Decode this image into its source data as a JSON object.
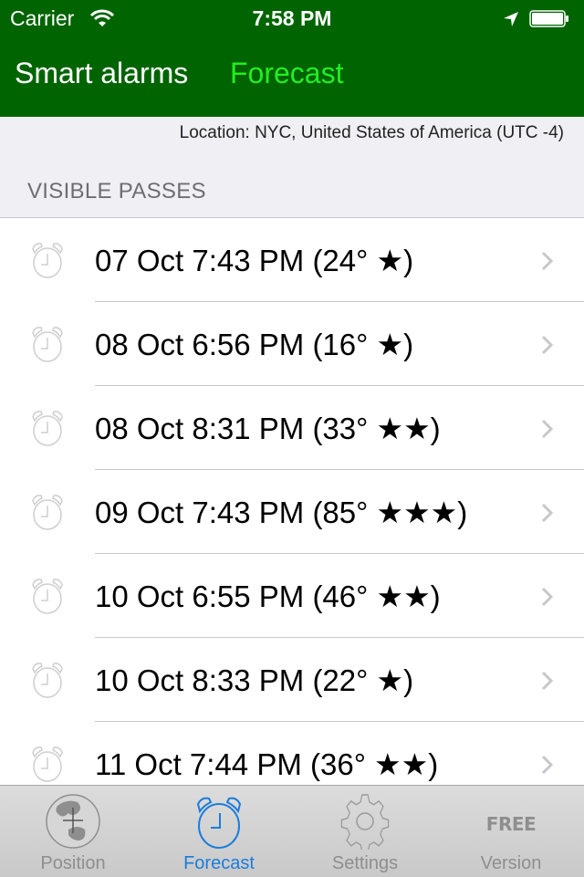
{
  "status_bar": {
    "carrier": "Carrier",
    "time": "7:58 PM",
    "icons": [
      "wifi-icon",
      "location-arrow-icon",
      "battery-icon"
    ]
  },
  "nav": {
    "items": [
      {
        "label": "Smart alarms",
        "selected": false
      },
      {
        "label": "Forecast",
        "selected": true
      }
    ],
    "colors": {
      "background": "#006400",
      "selected": "#22ee22",
      "normal": "#ffffff"
    }
  },
  "location_label": "Location: NYC, United States of America (UTC -4)",
  "section_header": "VISIBLE PASSES",
  "passes": [
    {
      "text": "07 Oct 7:43 PM (24° ★)",
      "date": "07 Oct",
      "time": "7:43 PM",
      "elevation": "24°",
      "stars": 1
    },
    {
      "text": "08 Oct 6:56 PM (16° ★)",
      "date": "08 Oct",
      "time": "6:56 PM",
      "elevation": "16°",
      "stars": 1
    },
    {
      "text": "08 Oct 8:31 PM (33° ★★)",
      "date": "08 Oct",
      "time": "8:31 PM",
      "elevation": "33°",
      "stars": 2
    },
    {
      "text": "09 Oct 7:43 PM (85° ★★★)",
      "date": "09 Oct",
      "time": "7:43 PM",
      "elevation": "85°",
      "stars": 3
    },
    {
      "text": "10 Oct 6:55 PM (46° ★★)",
      "date": "10 Oct",
      "time": "6:55 PM",
      "elevation": "46°",
      "stars": 2
    },
    {
      "text": "10 Oct 8:33 PM (22° ★)",
      "date": "10 Oct",
      "time": "8:33 PM",
      "elevation": "22°",
      "stars": 1
    },
    {
      "text": "11 Oct 7:44 PM (36° ★★)",
      "date": "11 Oct",
      "time": "7:44 PM",
      "elevation": "36°",
      "stars": 2
    }
  ],
  "tabbar": {
    "items": [
      {
        "label": "Position",
        "icon": "globe-icon",
        "active": false
      },
      {
        "label": "Forecast",
        "icon": "alarm-clock-icon",
        "active": true
      },
      {
        "label": "Settings",
        "icon": "gear-icon",
        "active": false
      },
      {
        "label": "Version",
        "icon": "free-badge-icon",
        "icon_text": "FREE",
        "active": false
      }
    ],
    "colors": {
      "active": "#1a7cdc",
      "inactive": "#8e8e8e"
    }
  }
}
